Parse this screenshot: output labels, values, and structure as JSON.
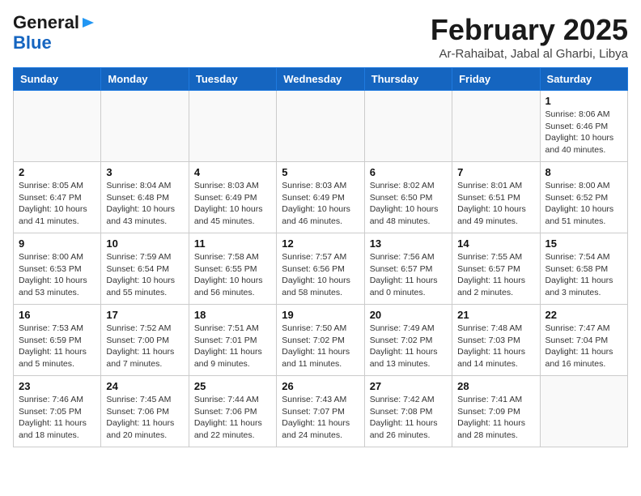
{
  "header": {
    "logo_line1a": "General",
    "logo_line1b": "",
    "logo_line2": "Blue",
    "month": "February 2025",
    "location": "Ar-Rahaibat, Jabal al Gharbi, Libya"
  },
  "weekdays": [
    "Sunday",
    "Monday",
    "Tuesday",
    "Wednesday",
    "Thursday",
    "Friday",
    "Saturday"
  ],
  "weeks": [
    [
      {
        "day": "",
        "info": ""
      },
      {
        "day": "",
        "info": ""
      },
      {
        "day": "",
        "info": ""
      },
      {
        "day": "",
        "info": ""
      },
      {
        "day": "",
        "info": ""
      },
      {
        "day": "",
        "info": ""
      },
      {
        "day": "1",
        "info": "Sunrise: 8:06 AM\nSunset: 6:46 PM\nDaylight: 10 hours and 40 minutes."
      }
    ],
    [
      {
        "day": "2",
        "info": "Sunrise: 8:05 AM\nSunset: 6:47 PM\nDaylight: 10 hours and 41 minutes."
      },
      {
        "day": "3",
        "info": "Sunrise: 8:04 AM\nSunset: 6:48 PM\nDaylight: 10 hours and 43 minutes."
      },
      {
        "day": "4",
        "info": "Sunrise: 8:03 AM\nSunset: 6:49 PM\nDaylight: 10 hours and 45 minutes."
      },
      {
        "day": "5",
        "info": "Sunrise: 8:03 AM\nSunset: 6:49 PM\nDaylight: 10 hours and 46 minutes."
      },
      {
        "day": "6",
        "info": "Sunrise: 8:02 AM\nSunset: 6:50 PM\nDaylight: 10 hours and 48 minutes."
      },
      {
        "day": "7",
        "info": "Sunrise: 8:01 AM\nSunset: 6:51 PM\nDaylight: 10 hours and 49 minutes."
      },
      {
        "day": "8",
        "info": "Sunrise: 8:00 AM\nSunset: 6:52 PM\nDaylight: 10 hours and 51 minutes."
      }
    ],
    [
      {
        "day": "9",
        "info": "Sunrise: 8:00 AM\nSunset: 6:53 PM\nDaylight: 10 hours and 53 minutes."
      },
      {
        "day": "10",
        "info": "Sunrise: 7:59 AM\nSunset: 6:54 PM\nDaylight: 10 hours and 55 minutes."
      },
      {
        "day": "11",
        "info": "Sunrise: 7:58 AM\nSunset: 6:55 PM\nDaylight: 10 hours and 56 minutes."
      },
      {
        "day": "12",
        "info": "Sunrise: 7:57 AM\nSunset: 6:56 PM\nDaylight: 10 hours and 58 minutes."
      },
      {
        "day": "13",
        "info": "Sunrise: 7:56 AM\nSunset: 6:57 PM\nDaylight: 11 hours and 0 minutes."
      },
      {
        "day": "14",
        "info": "Sunrise: 7:55 AM\nSunset: 6:57 PM\nDaylight: 11 hours and 2 minutes."
      },
      {
        "day": "15",
        "info": "Sunrise: 7:54 AM\nSunset: 6:58 PM\nDaylight: 11 hours and 3 minutes."
      }
    ],
    [
      {
        "day": "16",
        "info": "Sunrise: 7:53 AM\nSunset: 6:59 PM\nDaylight: 11 hours and 5 minutes."
      },
      {
        "day": "17",
        "info": "Sunrise: 7:52 AM\nSunset: 7:00 PM\nDaylight: 11 hours and 7 minutes."
      },
      {
        "day": "18",
        "info": "Sunrise: 7:51 AM\nSunset: 7:01 PM\nDaylight: 11 hours and 9 minutes."
      },
      {
        "day": "19",
        "info": "Sunrise: 7:50 AM\nSunset: 7:02 PM\nDaylight: 11 hours and 11 minutes."
      },
      {
        "day": "20",
        "info": "Sunrise: 7:49 AM\nSunset: 7:02 PM\nDaylight: 11 hours and 13 minutes."
      },
      {
        "day": "21",
        "info": "Sunrise: 7:48 AM\nSunset: 7:03 PM\nDaylight: 11 hours and 14 minutes."
      },
      {
        "day": "22",
        "info": "Sunrise: 7:47 AM\nSunset: 7:04 PM\nDaylight: 11 hours and 16 minutes."
      }
    ],
    [
      {
        "day": "23",
        "info": "Sunrise: 7:46 AM\nSunset: 7:05 PM\nDaylight: 11 hours and 18 minutes."
      },
      {
        "day": "24",
        "info": "Sunrise: 7:45 AM\nSunset: 7:06 PM\nDaylight: 11 hours and 20 minutes."
      },
      {
        "day": "25",
        "info": "Sunrise: 7:44 AM\nSunset: 7:06 PM\nDaylight: 11 hours and 22 minutes."
      },
      {
        "day": "26",
        "info": "Sunrise: 7:43 AM\nSunset: 7:07 PM\nDaylight: 11 hours and 24 minutes."
      },
      {
        "day": "27",
        "info": "Sunrise: 7:42 AM\nSunset: 7:08 PM\nDaylight: 11 hours and 26 minutes."
      },
      {
        "day": "28",
        "info": "Sunrise: 7:41 AM\nSunset: 7:09 PM\nDaylight: 11 hours and 28 minutes."
      },
      {
        "day": "",
        "info": ""
      }
    ]
  ]
}
